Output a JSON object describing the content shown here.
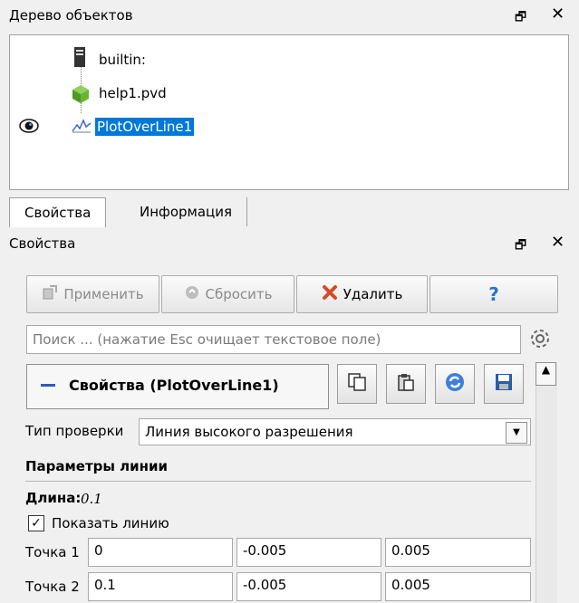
{
  "pipeline_browser": {
    "title": "Дерево объектов",
    "items": [
      {
        "label": "builtin:",
        "icon": "server-icon"
      },
      {
        "label": "help1.pvd",
        "icon": "cube-icon"
      },
      {
        "label": "PlotOverLine1",
        "icon": "line-chart-icon",
        "selected": true
      }
    ]
  },
  "tabs": [
    {
      "label": "Свойства"
    },
    {
      "label": "Информация"
    }
  ],
  "properties": {
    "title": "Свойства",
    "buttons": {
      "apply": "Применить",
      "reset": "Сбросить",
      "delete": "Удалить",
      "help": "?"
    },
    "search_placeholder": "Поиск ... (нажатие Esc очищает текстовое поле)",
    "section_title": "Свойства (PlotOverLine1)",
    "probe_type_label": "Тип проверки",
    "probe_type_value": "Линия высокого разрешения",
    "line_params_title": "Параметры линии",
    "length_label": "Длина:",
    "length_value": "0.1",
    "show_line_label": "Показать линию",
    "show_line_checked": true,
    "point1_label": "Точка 1",
    "point1": [
      "0",
      "-0.005",
      "0.005"
    ],
    "point2_label": "Точка 2",
    "point2": [
      "0.1",
      "-0.005",
      "0.005"
    ]
  },
  "colors": {
    "selection": "#0078d7",
    "delete": "#d64b2c",
    "help": "#2b73c8"
  }
}
